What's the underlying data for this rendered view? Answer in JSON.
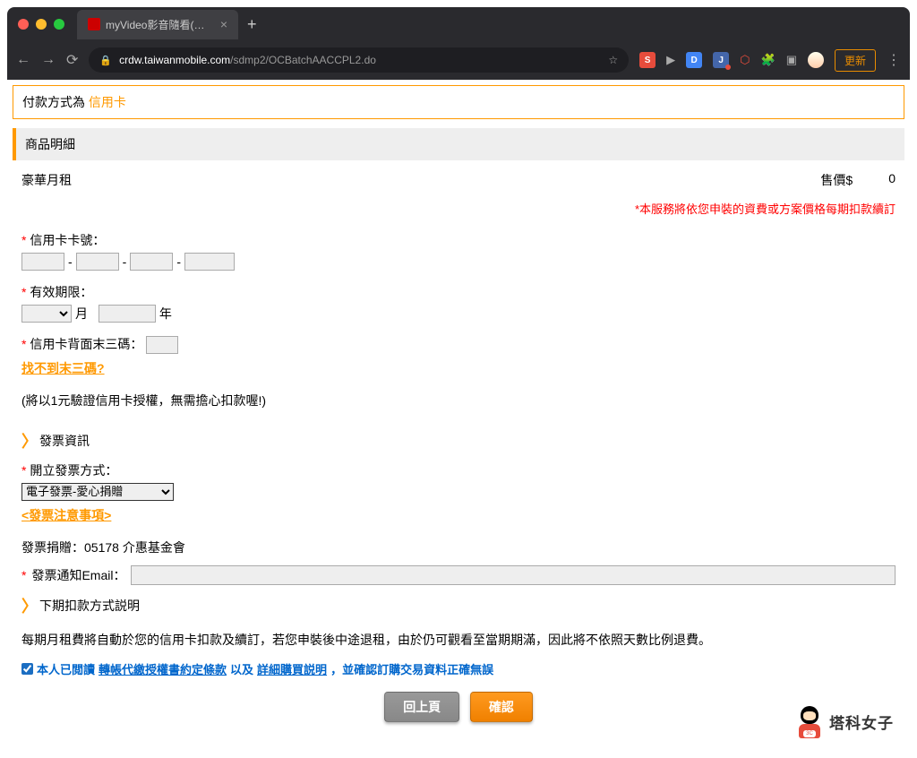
{
  "browser": {
    "tab_title": "myVideo影音隨看(手機版) - 購",
    "url_domain": "crdw.taiwanmobile.com",
    "url_path": "/sdmp2/OCBatchAACCPL2.do",
    "update_btn": "更新",
    "new_tab": "+",
    "tab_close": "×",
    "star": "☆",
    "menu": "⋮"
  },
  "header": {
    "payment_prefix": "付款方式為",
    "payment_method": "信用卡"
  },
  "product_section": {
    "title": "商品明細",
    "item_name": "豪華月租",
    "price_label": "售價$",
    "price_value": "0"
  },
  "notice": "*本服務將依您申裝的資費或方案價格每期扣款續訂",
  "cc": {
    "number_label": "信用卡卡號：",
    "dash": "-",
    "expiry_label": "有效期限：",
    "month_suffix": "月",
    "year_suffix": "年",
    "cvc_label": "信用卡背面末三碼：",
    "help_link": "找不到末三碼?",
    "note": "(將以1元驗證信用卡授權，無需擔心扣款喔!)"
  },
  "invoice": {
    "section": "發票資訊",
    "method_label": "開立發票方式：",
    "method_value": "電子發票-愛心捐贈",
    "notes_link": "<發票注意事項>",
    "donation": "發票捐贈：05178 介惠基金會",
    "email_label": "發票通知Email："
  },
  "next_payment": {
    "section": "下期扣款方式説明",
    "desc": "每期月租費將自動於您的信用卡扣款及續訂，若您申裝後中途退租，由於仍可觀看至當期期滿，因此將不依照天數比例退費。"
  },
  "agree": {
    "prefix": "本人已閲讀",
    "link1": "轉帳代繳授權書約定條款",
    "mid": "以及",
    "link2": "詳細購買説明",
    "suffix": "，並確認訂購交易資料正確無誤"
  },
  "buttons": {
    "back": "回上頁",
    "confirm": "確認"
  },
  "watermark": {
    "badge": "3C",
    "text": "塔科女子"
  },
  "req": "*",
  "chev": "〉"
}
